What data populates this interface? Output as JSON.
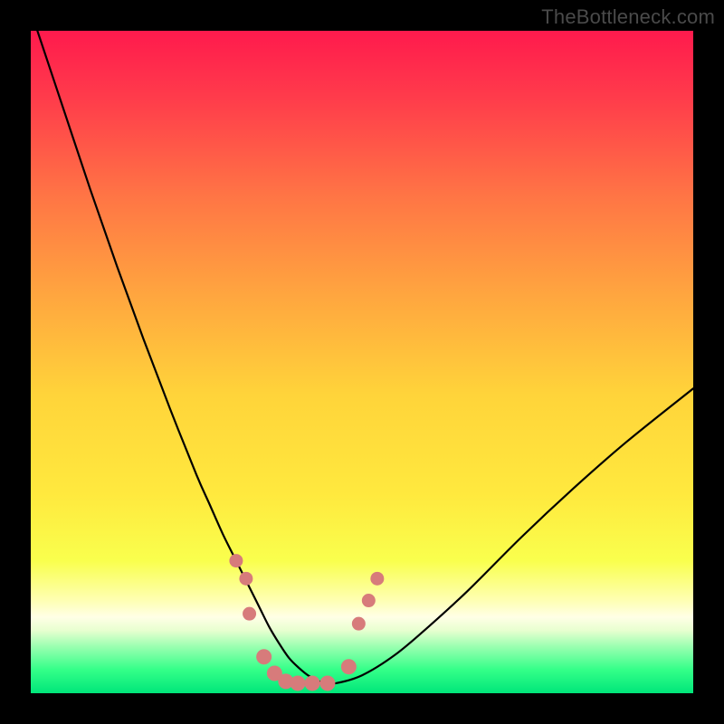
{
  "watermark": {
    "text": "TheBottleneck.com"
  },
  "colors": {
    "black": "#000000",
    "curve": "#000000",
    "marker_fill": "#d77b7b",
    "marker_stroke": "#d77b7b"
  },
  "gradient_stops": [
    {
      "offset": 0.0,
      "color": "#ff1a4d"
    },
    {
      "offset": 0.1,
      "color": "#ff3b4b"
    },
    {
      "offset": 0.25,
      "color": "#ff7545"
    },
    {
      "offset": 0.4,
      "color": "#ffa63f"
    },
    {
      "offset": 0.55,
      "color": "#ffd43a"
    },
    {
      "offset": 0.7,
      "color": "#ffe93e"
    },
    {
      "offset": 0.8,
      "color": "#f9ff4d"
    },
    {
      "offset": 0.86,
      "color": "#feffb3"
    },
    {
      "offset": 0.885,
      "color": "#ffffe6"
    },
    {
      "offset": 0.905,
      "color": "#e8ffd0"
    },
    {
      "offset": 0.93,
      "color": "#99ffb0"
    },
    {
      "offset": 0.965,
      "color": "#33ff88"
    },
    {
      "offset": 1.0,
      "color": "#00e67a"
    }
  ],
  "chart_data": {
    "type": "line",
    "title": "",
    "xlabel": "",
    "ylabel": "",
    "xlim": [
      0,
      100
    ],
    "ylim": [
      0,
      100
    ],
    "series": [
      {
        "name": "bottleneck-curve",
        "x": [
          1,
          5,
          9,
          13,
          17,
          21,
          25,
          27,
          29,
          31,
          33,
          34.5,
          36,
          37.5,
          39,
          40.5,
          42,
          44,
          46,
          50,
          55,
          60,
          66,
          74,
          82,
          90,
          100
        ],
        "y": [
          100,
          88,
          76,
          64.5,
          53.5,
          43,
          33,
          28.5,
          24,
          20,
          16,
          13,
          10,
          7.5,
          5.3,
          3.8,
          2.6,
          1.6,
          1.5,
          2.7,
          5.8,
          10,
          15.5,
          23.5,
          31,
          38,
          46
        ]
      }
    ],
    "markers": {
      "name": "highlight-dots",
      "points": [
        {
          "x": 31.0,
          "y": 20.0,
          "r": 7
        },
        {
          "x": 32.5,
          "y": 17.3,
          "r": 7
        },
        {
          "x": 33.0,
          "y": 12.0,
          "r": 7
        },
        {
          "x": 35.2,
          "y": 5.5,
          "r": 8
        },
        {
          "x": 36.8,
          "y": 3.0,
          "r": 8
        },
        {
          "x": 38.5,
          "y": 1.8,
          "r": 8
        },
        {
          "x": 40.3,
          "y": 1.5,
          "r": 8
        },
        {
          "x": 42.5,
          "y": 1.5,
          "r": 8
        },
        {
          "x": 44.8,
          "y": 1.5,
          "r": 8
        },
        {
          "x": 48.0,
          "y": 4.0,
          "r": 8
        },
        {
          "x": 49.5,
          "y": 10.5,
          "r": 7
        },
        {
          "x": 51.0,
          "y": 14.0,
          "r": 7
        },
        {
          "x": 52.3,
          "y": 17.3,
          "r": 7
        }
      ]
    }
  }
}
